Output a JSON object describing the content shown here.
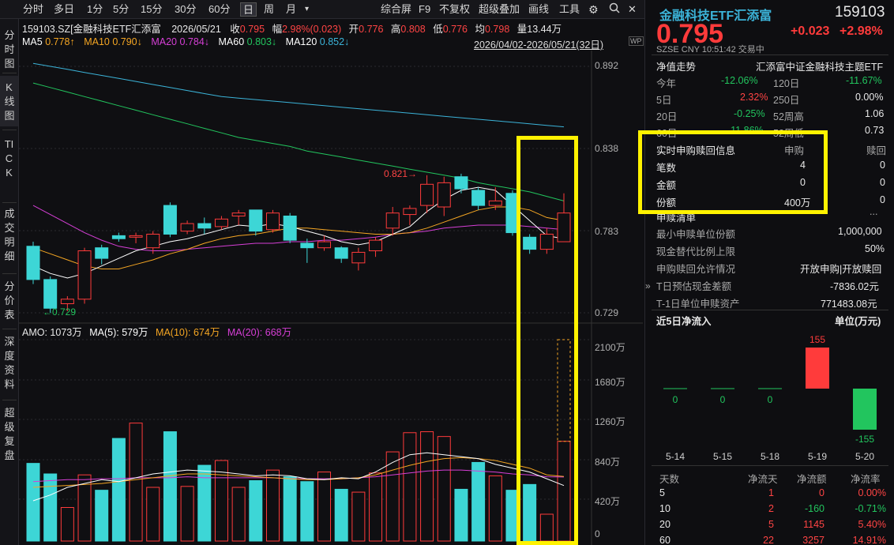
{
  "toolbar": {
    "items": [
      {
        "label": "分时"
      },
      {
        "label": "多日"
      },
      {
        "label": "1分"
      },
      {
        "label": "5分"
      },
      {
        "label": "15分"
      },
      {
        "label": "30分"
      },
      {
        "label": "60分"
      },
      {
        "label": "日"
      },
      {
        "label": "周"
      },
      {
        "label": "月"
      }
    ],
    "dropdown": "▾",
    "right_items": [
      {
        "label": "综合屏"
      },
      {
        "label": "F9"
      },
      {
        "label": "不复权"
      },
      {
        "label": "超级叠加"
      },
      {
        "label": "画线"
      },
      {
        "label": "工具"
      }
    ]
  },
  "left_sidebar": [
    "分时图",
    "K线图",
    "TICK",
    "成交明细",
    "分价表",
    "深度资料",
    "超级复盘"
  ],
  "chart_header": {
    "code": "159103.SZ[金融科技ETF汇添富",
    "date": "2026/05/21",
    "close_label": "收",
    "close": "0.795",
    "chg_label": "幅",
    "chg": "2.98%(0.023)",
    "open_label": "开",
    "open": "0.776",
    "high_label": "高",
    "high": "0.808",
    "low_label": "低",
    "low": "0.776",
    "avg_label": "均",
    "avg": "0.798",
    "vol_label": "量",
    "vol": "13.44万",
    "date_range": "2026/04/02-2026/05/21(32日)"
  },
  "ma_legend": [
    {
      "label": "MA5",
      "value": "0.778↑",
      "color": "#ffffff"
    },
    {
      "label": "MA10",
      "value": "0.790↓",
      "color": "#f5a623"
    },
    {
      "label": "MA20",
      "value": "0.784↓",
      "color": "#d63fd6"
    },
    {
      "label": "MA60",
      "value": "0.803↓",
      "color": "#22c55e"
    },
    {
      "label": "MA120",
      "value": "0.852↓",
      "color": "#3bb3d8"
    }
  ],
  "price_axis": [
    "0.892",
    "0.838",
    "0.783",
    "0.729"
  ],
  "price_annotations": {
    "high": "0.821→",
    "low": "←0.729"
  },
  "amo_legend": {
    "amo": "AMO: 1073万",
    "ma5": "MA(5): 579万",
    "ma10": "MA(10): 674万",
    "ma20": "MA(20): 668万"
  },
  "vol_axis": [
    "2100万",
    "1680万",
    "1260万",
    "840万",
    "420万",
    "0"
  ],
  "chart_data": {
    "type": "candlestick",
    "ylim": [
      0.72,
      0.9
    ],
    "candles": [
      [
        0.773,
        0.751,
        0.776,
        0.748
      ],
      [
        0.751,
        0.732,
        0.753,
        0.729
      ],
      [
        0.735,
        0.738,
        0.74,
        0.73
      ],
      [
        0.738,
        0.77,
        0.772,
        0.735
      ],
      [
        0.772,
        0.765,
        0.774,
        0.761
      ],
      [
        0.78,
        0.778,
        0.782,
        0.776
      ],
      [
        0.779,
        0.78,
        0.782,
        0.775
      ],
      [
        0.772,
        0.781,
        0.783,
        0.768
      ],
      [
        0.8,
        0.781,
        0.802,
        0.779
      ],
      [
        0.783,
        0.788,
        0.79,
        0.781
      ],
      [
        0.788,
        0.785,
        0.792,
        0.781
      ],
      [
        0.786,
        0.791,
        0.793,
        0.784
      ],
      [
        0.793,
        0.795,
        0.797,
        0.787
      ],
      [
        0.797,
        0.783,
        0.797,
        0.78
      ],
      [
        0.784,
        0.795,
        0.797,
        0.782
      ],
      [
        0.793,
        0.777,
        0.795,
        0.775
      ],
      [
        0.775,
        0.772,
        0.778,
        0.762
      ],
      [
        0.772,
        0.776,
        0.78,
        0.77
      ],
      [
        0.772,
        0.765,
        0.773,
        0.762
      ],
      [
        0.762,
        0.769,
        0.772,
        0.757
      ],
      [
        0.77,
        0.777,
        0.779,
        0.766
      ],
      [
        0.785,
        0.795,
        0.799,
        0.78
      ],
      [
        0.794,
        0.798,
        0.8,
        0.787
      ],
      [
        0.8,
        0.814,
        0.82,
        0.795
      ],
      [
        0.799,
        0.815,
        0.819,
        0.793
      ],
      [
        0.819,
        0.811,
        0.821,
        0.808
      ],
      [
        0.81,
        0.8,
        0.812,
        0.797
      ],
      [
        0.8,
        0.803,
        0.812,
        0.797
      ],
      [
        0.808,
        0.782,
        0.81,
        0.78
      ],
      [
        0.779,
        0.771,
        0.781,
        0.768
      ],
      [
        0.771,
        0.781,
        0.785,
        0.768
      ],
      [
        0.776,
        0.795,
        0.808,
        0.776
      ]
    ],
    "volumes": [
      810,
      700,
      350,
      690,
      530,
      1070,
      1230,
      560,
      1140,
      570,
      790,
      840,
      560,
      630,
      740,
      670,
      620,
      720,
      540,
      510,
      710,
      930,
      1130,
      1140,
      1090,
      540,
      820,
      680,
      530,
      590,
      280,
      1040
    ],
    "amo_ma": {
      "ma5": [
        420,
        480,
        560,
        600,
        640,
        620,
        660,
        700,
        720,
        740,
        730,
        720,
        700,
        680,
        690,
        680,
        650,
        640,
        660,
        650,
        720,
        820,
        900,
        920,
        900,
        880,
        860,
        800,
        760,
        720,
        650,
        579
      ],
      "ma10": [
        560,
        570,
        580,
        590,
        600,
        620,
        640,
        660,
        680,
        700,
        700,
        690,
        680,
        670,
        660,
        650,
        640,
        640,
        650,
        660,
        690,
        740,
        790,
        830,
        860,
        870,
        860,
        840,
        800,
        760,
        690,
        674
      ],
      "ma20": [
        620,
        630,
        640,
        640,
        650,
        650,
        660,
        660,
        660,
        670,
        660,
        660,
        660,
        660,
        660,
        650,
        650,
        650,
        650,
        660,
        670,
        690,
        710,
        730,
        740,
        740,
        730,
        720,
        700,
        690,
        670,
        668
      ]
    },
    "ma_lines": {
      "ma5": [
        0.76,
        0.755,
        0.752,
        0.755,
        0.76,
        0.765,
        0.77,
        0.773,
        0.776,
        0.778,
        0.781,
        0.784,
        0.787,
        0.786,
        0.788,
        0.786,
        0.783,
        0.78,
        0.776,
        0.774,
        0.776,
        0.781,
        0.786,
        0.796,
        0.804,
        0.81,
        0.812,
        0.81,
        0.8,
        0.79,
        0.78,
        0.778
      ],
      "ma10": [
        0.772,
        0.768,
        0.764,
        0.76,
        0.758,
        0.758,
        0.761,
        0.764,
        0.768,
        0.771,
        0.775,
        0.778,
        0.78,
        0.781,
        0.783,
        0.785,
        0.785,
        0.784,
        0.783,
        0.782,
        0.781,
        0.781,
        0.782,
        0.785,
        0.789,
        0.793,
        0.797,
        0.799,
        0.799,
        0.797,
        0.792,
        0.79
      ],
      "ma20": [
        0.8,
        0.794,
        0.788,
        0.782,
        0.777,
        0.773,
        0.771,
        0.77,
        0.77,
        0.771,
        0.772,
        0.773,
        0.774,
        0.775,
        0.775,
        0.776,
        0.776,
        0.777,
        0.777,
        0.778,
        0.779,
        0.781,
        0.782,
        0.783,
        0.785,
        0.786,
        0.787,
        0.787,
        0.787,
        0.786,
        0.785,
        0.784
      ],
      "ma60": [
        0.881,
        0.878,
        0.875,
        0.872,
        0.869,
        0.866,
        0.863,
        0.86,
        0.857,
        0.854,
        0.851,
        0.848,
        0.845,
        0.843,
        0.841,
        0.839,
        0.836,
        0.834,
        0.832,
        0.83,
        0.828,
        0.826,
        0.824,
        0.822,
        0.82,
        0.818,
        0.815,
        0.813,
        0.811,
        0.809,
        0.806,
        0.803
      ],
      "ma120": [
        0.894,
        0.892,
        0.89,
        0.888,
        0.886,
        0.884,
        0.882,
        0.88,
        0.878,
        0.876,
        0.874,
        0.872,
        0.871,
        0.87,
        0.869,
        0.868,
        0.867,
        0.866,
        0.865,
        0.864,
        0.863,
        0.862,
        0.861,
        0.86,
        0.859,
        0.858,
        0.857,
        0.856,
        0.855,
        0.854,
        0.853,
        0.852
      ]
    }
  },
  "quote": {
    "name": "金融科技ETF汇添富",
    "code": "159103",
    "price": "0.795",
    "chg": "+0.023",
    "pct": "+2.98%",
    "market": "SZSE",
    "currency": "CNY",
    "time": "10:51:42",
    "status": "交易中"
  },
  "nav": {
    "title": "净值走势",
    "name": "汇添富中证金融科技主题ETF",
    "rows": [
      {
        "l1": "今年",
        "v1": "-12.06%",
        "l2": "120日",
        "v2": "-11.67%"
      },
      {
        "l1": "5日",
        "v1": "2.32%",
        "l2": "250日",
        "v2": "0.00%"
      },
      {
        "l1": "20日",
        "v1": "-0.25%",
        "l2": "52周高",
        "v2": "1.06"
      },
      {
        "l1": "60日",
        "v1": "-11.86%",
        "l2": "52周低",
        "v2": "0.73"
      }
    ]
  },
  "subred": {
    "title": "实时申购赎回信息",
    "col1": "申购",
    "col2": "赎回",
    "rows": [
      {
        "l": "笔数",
        "a": "4",
        "b": "0"
      },
      {
        "l": "金额",
        "a": "0",
        "b": "0"
      },
      {
        "l": "份额",
        "a": "400万",
        "b": "0"
      }
    ]
  },
  "list": {
    "title": "申赎清单",
    "more": "...",
    "rows": [
      {
        "l": "最小申赎单位份额",
        "v": "1,000,000"
      },
      {
        "l": "现金替代比例上限",
        "v": "50%"
      },
      {
        "l": "申购赎回允许情况",
        "v": "开放申购|开放赎回"
      },
      {
        "l": "T日预估现金差额",
        "v": "-7836.02元"
      },
      {
        "l": "T-1日单位申赎资产",
        "v": "771483.08元"
      }
    ]
  },
  "inflow": {
    "title": "近5日净流入",
    "unit": "单位(万元)",
    "dates": [
      "5-14",
      "5-15",
      "5-18",
      "5-19",
      "5-20"
    ],
    "values": [
      0,
      0,
      0,
      155,
      -155
    ],
    "labels": [
      "0",
      "0",
      "0",
      "155",
      "-155"
    ]
  },
  "flow": {
    "headers": [
      "天数",
      "净流天",
      "净流额",
      "净流率"
    ],
    "rows": [
      [
        "5",
        "1",
        "0",
        "0.00%"
      ],
      [
        "10",
        "2",
        "-160",
        "-0.71%"
      ],
      [
        "20",
        "5",
        "1145",
        "5.40%"
      ],
      [
        "60",
        "22",
        "3257",
        "14.91%"
      ]
    ]
  }
}
